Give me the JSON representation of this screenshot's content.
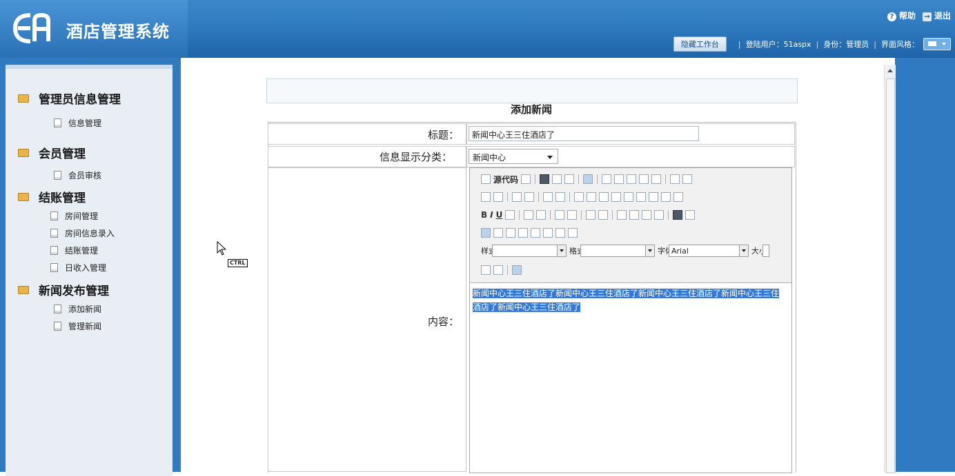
{
  "header": {
    "app_title": "酒店管理系统",
    "help_label": "帮助",
    "exit_label": "退出",
    "hide_workbench": "隐藏工作台",
    "login_user": "登陆用户：51aspx",
    "identity": "身份：管理员",
    "theme_label": "界面风格："
  },
  "sidebar": {
    "groups": [
      {
        "title": "管理员信息管理",
        "items": [
          "信息管理"
        ]
      },
      {
        "title": "会员管理",
        "items": [
          "会员审核"
        ]
      },
      {
        "title": "结账管理",
        "items": [
          "房间管理",
          "房间信息录入",
          "结账管理",
          "日收入管理"
        ]
      },
      {
        "title": "新闻发布管理",
        "items": [
          "添加新闻",
          "管理新闻"
        ]
      }
    ]
  },
  "form": {
    "title": "添加新闻",
    "title_label": "标题：",
    "title_value": "新闻中心王三住酒店了",
    "category_label": "信息显示分类：",
    "category_value": "新闻中心",
    "content_label": "内容：",
    "content_text": "新闻中心王三住酒店了新闻中心王三住酒店了新闻中心王三住酒店了新闻中心王三住酒店了新闻中心王三住酒店了"
  },
  "editor": {
    "source_label": "源代码",
    "style_label": "样式",
    "format_label": "格式",
    "font_label": "字体",
    "size_label": "大小",
    "font_value": "Arial"
  },
  "cursor": {
    "badge": "CTRL"
  }
}
